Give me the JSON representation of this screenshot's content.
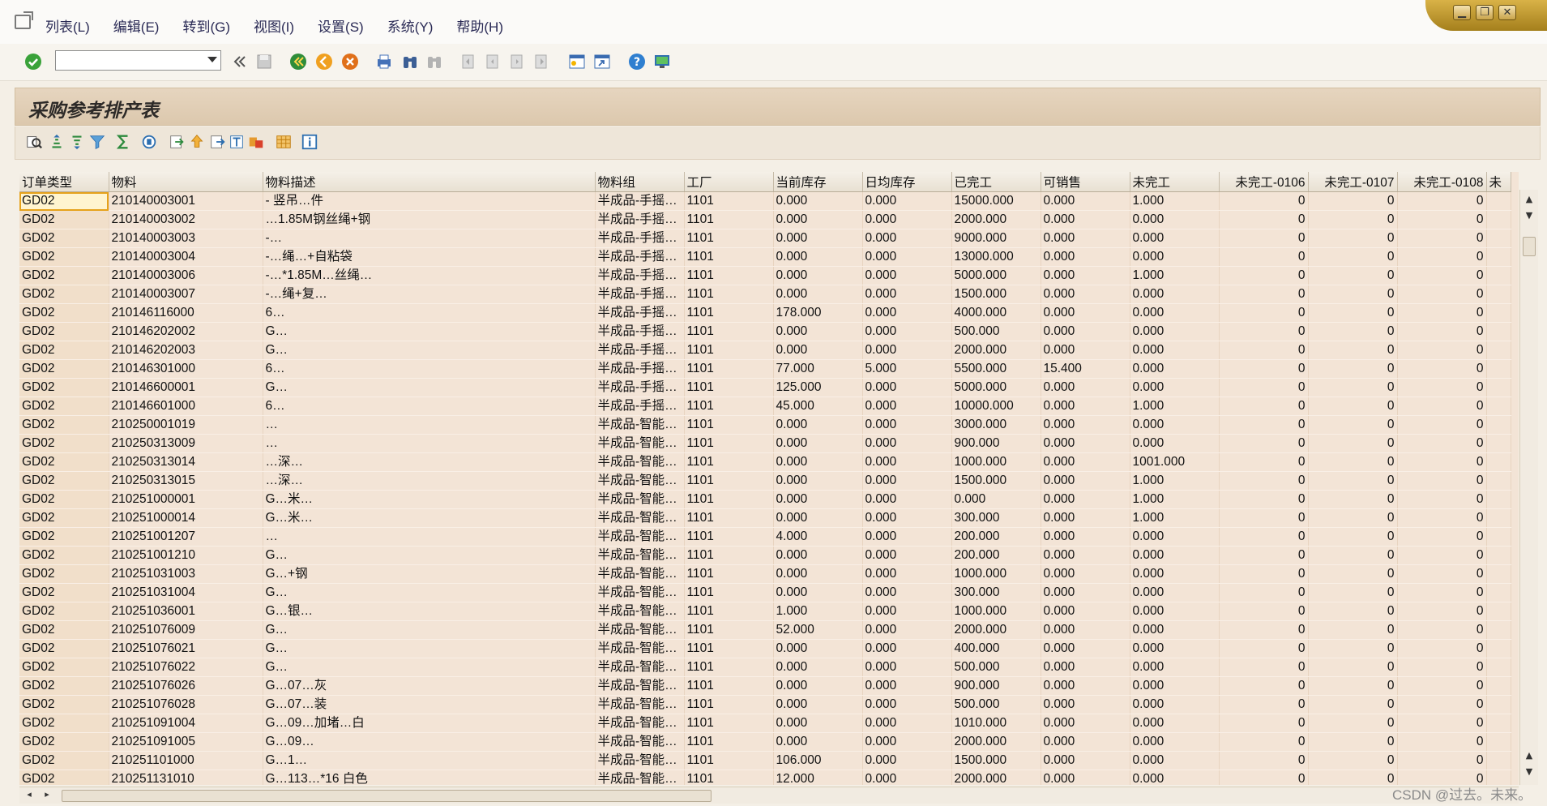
{
  "menubar": {
    "items": [
      "列表(L)",
      "编辑(E)",
      "转到(G)",
      "视图(I)",
      "设置(S)",
      "系统(Y)",
      "帮助(H)"
    ]
  },
  "window_controls": {
    "minimize": "▁",
    "restore": "❐",
    "close": "✕"
  },
  "toolbar": {
    "command_value": "",
    "icons": [
      "confirm-icon",
      "back-double-icon",
      "save-icon",
      "back-icon",
      "exit-icon",
      "cancel-icon",
      "print-icon",
      "find-icon",
      "find-next-icon",
      "first-page-icon",
      "prev-page-icon",
      "next-page-icon",
      "last-page-icon",
      "create-session-icon",
      "shortcut-icon",
      "help-icon",
      "layout-icon"
    ]
  },
  "page_title": "采购参考排产表",
  "alv_toolbar": {
    "icons": [
      "details-icon",
      "sort-asc-icon",
      "sort-desc-icon",
      "filter-icon",
      "sum-icon",
      "print-preview-icon",
      "export-icon",
      "upload-icon",
      "spreadsheet-icon",
      "word-icon",
      "abc-analysis-icon",
      "layout-grid-icon",
      "info-icon"
    ]
  },
  "grid": {
    "columns": [
      {
        "key": "type",
        "label": "订单类型"
      },
      {
        "key": "mat",
        "label": "物料"
      },
      {
        "key": "desc",
        "label": "物料描述"
      },
      {
        "key": "grp",
        "label": "物料组"
      },
      {
        "key": "plant",
        "label": "工厂"
      },
      {
        "key": "stock",
        "label": "当前库存"
      },
      {
        "key": "daily",
        "label": "日均库存"
      },
      {
        "key": "done",
        "label": "已完工"
      },
      {
        "key": "sale",
        "label": "可销售"
      },
      {
        "key": "undone",
        "label": "未完工"
      },
      {
        "key": "u0106",
        "label": "未完工-0106"
      },
      {
        "key": "u0107",
        "label": "未完工-0107"
      },
      {
        "key": "u0108",
        "label": "未完工-0108"
      },
      {
        "key": "u0109",
        "label": "未"
      }
    ],
    "rows": [
      [
        "GD02",
        "210140003001",
        "- 竖吊…件",
        "半成品-手摇…",
        "1101",
        "0.000",
        "0.000",
        "15000.000",
        "0.000",
        "1.000",
        "0",
        "0",
        "0",
        ""
      ],
      [
        "GD02",
        "210140003002",
        "…1.85M钢丝绳+钢",
        "半成品-手摇…",
        "1101",
        "0.000",
        "0.000",
        "2000.000",
        "0.000",
        "0.000",
        "0",
        "0",
        "0",
        ""
      ],
      [
        "GD02",
        "210140003003",
        "-…",
        "半成品-手摇…",
        "1101",
        "0.000",
        "0.000",
        "9000.000",
        "0.000",
        "0.000",
        "0",
        "0",
        "0",
        ""
      ],
      [
        "GD02",
        "210140003004",
        "-…绳…+自粘袋",
        "半成品-手摇…",
        "1101",
        "0.000",
        "0.000",
        "13000.000",
        "0.000",
        "0.000",
        "0",
        "0",
        "0",
        ""
      ],
      [
        "GD02",
        "210140003006",
        "-…*1.85M…丝绳…",
        "半成品-手摇…",
        "1101",
        "0.000",
        "0.000",
        "5000.000",
        "0.000",
        "1.000",
        "0",
        "0",
        "0",
        ""
      ],
      [
        "GD02",
        "210140003007",
        "-…绳+复…",
        "半成品-手摇…",
        "1101",
        "0.000",
        "0.000",
        "1500.000",
        "0.000",
        "0.000",
        "0",
        "0",
        "0",
        ""
      ],
      [
        "GD02",
        "210146116000",
        "6…",
        "半成品-手摇…",
        "1101",
        "178.000",
        "0.000",
        "4000.000",
        "0.000",
        "0.000",
        "0",
        "0",
        "0",
        ""
      ],
      [
        "GD02",
        "210146202002",
        "G…",
        "半成品-手摇…",
        "1101",
        "0.000",
        "0.000",
        "500.000",
        "0.000",
        "0.000",
        "0",
        "0",
        "0",
        ""
      ],
      [
        "GD02",
        "210146202003",
        "G…",
        "半成品-手摇…",
        "1101",
        "0.000",
        "0.000",
        "2000.000",
        "0.000",
        "0.000",
        "0",
        "0",
        "0",
        ""
      ],
      [
        "GD02",
        "210146301000",
        "6…",
        "半成品-手摇…",
        "1101",
        "77.000",
        "5.000",
        "5500.000",
        "15.400",
        "0.000",
        "0",
        "0",
        "0",
        ""
      ],
      [
        "GD02",
        "210146600001",
        "G…",
        "半成品-手摇…",
        "1101",
        "125.000",
        "0.000",
        "5000.000",
        "0.000",
        "0.000",
        "0",
        "0",
        "0",
        ""
      ],
      [
        "GD02",
        "210146601000",
        "6…",
        "半成品-手摇…",
        "1101",
        "45.000",
        "0.000",
        "10000.000",
        "0.000",
        "1.000",
        "0",
        "0",
        "0",
        ""
      ],
      [
        "GD02",
        "210250001019",
        "…",
        "半成品-智能…",
        "1101",
        "0.000",
        "0.000",
        "3000.000",
        "0.000",
        "0.000",
        "0",
        "0",
        "0",
        ""
      ],
      [
        "GD02",
        "210250313009",
        "…",
        "半成品-智能…",
        "1101",
        "0.000",
        "0.000",
        "900.000",
        "0.000",
        "0.000",
        "0",
        "0",
        "0",
        ""
      ],
      [
        "GD02",
        "210250313014",
        "…深…",
        "半成品-智能…",
        "1101",
        "0.000",
        "0.000",
        "1000.000",
        "0.000",
        "1001.000",
        "0",
        "0",
        "0",
        ""
      ],
      [
        "GD02",
        "210250313015",
        "…深…",
        "半成品-智能…",
        "1101",
        "0.000",
        "0.000",
        "1500.000",
        "0.000",
        "1.000",
        "0",
        "0",
        "0",
        ""
      ],
      [
        "GD02",
        "210251000001",
        "G…米…",
        "半成品-智能…",
        "1101",
        "0.000",
        "0.000",
        "0.000",
        "0.000",
        "1.000",
        "0",
        "0",
        "0",
        ""
      ],
      [
        "GD02",
        "210251000014",
        "G…米…",
        "半成品-智能…",
        "1101",
        "0.000",
        "0.000",
        "300.000",
        "0.000",
        "1.000",
        "0",
        "0",
        "0",
        ""
      ],
      [
        "GD02",
        "210251001207",
        "…",
        "半成品-智能…",
        "1101",
        "4.000",
        "0.000",
        "200.000",
        "0.000",
        "0.000",
        "0",
        "0",
        "0",
        ""
      ],
      [
        "GD02",
        "210251001210",
        "G…",
        "半成品-智能…",
        "1101",
        "0.000",
        "0.000",
        "200.000",
        "0.000",
        "0.000",
        "0",
        "0",
        "0",
        ""
      ],
      [
        "GD02",
        "210251031003",
        "G…+钢",
        "半成品-智能…",
        "1101",
        "0.000",
        "0.000",
        "1000.000",
        "0.000",
        "0.000",
        "0",
        "0",
        "0",
        ""
      ],
      [
        "GD02",
        "210251031004",
        "G…",
        "半成品-智能…",
        "1101",
        "0.000",
        "0.000",
        "300.000",
        "0.000",
        "0.000",
        "0",
        "0",
        "0",
        ""
      ],
      [
        "GD02",
        "210251036001",
        "G…银…",
        "半成品-智能…",
        "1101",
        "1.000",
        "0.000",
        "1000.000",
        "0.000",
        "0.000",
        "0",
        "0",
        "0",
        ""
      ],
      [
        "GD02",
        "210251076009",
        "G…",
        "半成品-智能…",
        "1101",
        "52.000",
        "0.000",
        "2000.000",
        "0.000",
        "0.000",
        "0",
        "0",
        "0",
        ""
      ],
      [
        "GD02",
        "210251076021",
        "G…",
        "半成品-智能…",
        "1101",
        "0.000",
        "0.000",
        "400.000",
        "0.000",
        "0.000",
        "0",
        "0",
        "0",
        ""
      ],
      [
        "GD02",
        "210251076022",
        "G…",
        "半成品-智能…",
        "1101",
        "0.000",
        "0.000",
        "500.000",
        "0.000",
        "0.000",
        "0",
        "0",
        "0",
        ""
      ],
      [
        "GD02",
        "210251076026",
        "G…07…灰",
        "半成品-智能…",
        "1101",
        "0.000",
        "0.000",
        "900.000",
        "0.000",
        "0.000",
        "0",
        "0",
        "0",
        ""
      ],
      [
        "GD02",
        "210251076028",
        "G…07…装",
        "半成品-智能…",
        "1101",
        "0.000",
        "0.000",
        "500.000",
        "0.000",
        "0.000",
        "0",
        "0",
        "0",
        ""
      ],
      [
        "GD02",
        "210251091004",
        "G…09…加堵…白",
        "半成品-智能…",
        "1101",
        "0.000",
        "0.000",
        "1010.000",
        "0.000",
        "0.000",
        "0",
        "0",
        "0",
        ""
      ],
      [
        "GD02",
        "210251091005",
        "G…09…",
        "半成品-智能…",
        "1101",
        "0.000",
        "0.000",
        "2000.000",
        "0.000",
        "0.000",
        "0",
        "0",
        "0",
        ""
      ],
      [
        "GD02",
        "210251101000",
        "G…1…",
        "半成品-智能…",
        "1101",
        "106.000",
        "0.000",
        "1500.000",
        "0.000",
        "0.000",
        "0",
        "0",
        "0",
        ""
      ],
      [
        "GD02",
        "210251131010",
        "G…113…*16 白色",
        "半成品-智能…",
        "1101",
        "12.000",
        "0.000",
        "2000.000",
        "0.000",
        "0.000",
        "0",
        "0",
        "0",
        ""
      ]
    ]
  },
  "watermark": "CSDN @过去。未来。"
}
